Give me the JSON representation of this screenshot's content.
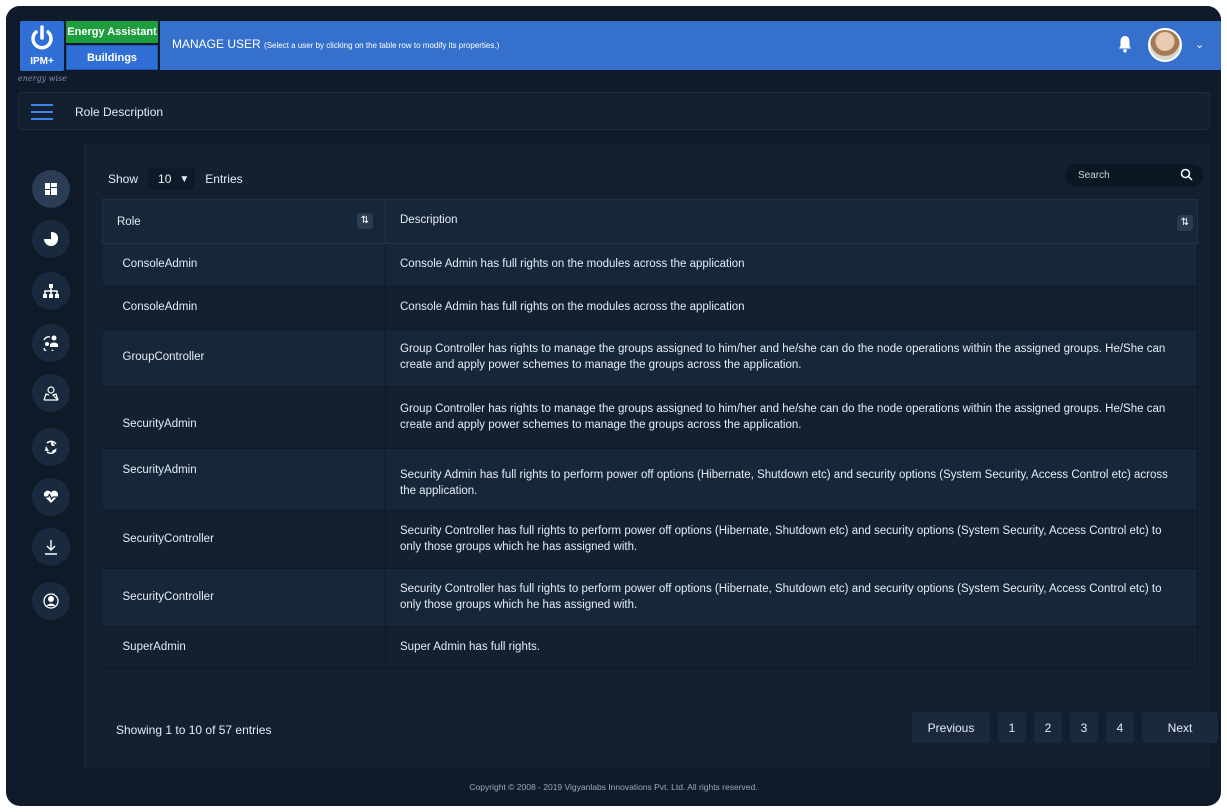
{
  "app": {
    "logo_text": "IPM+",
    "logo_sub": "energy wise",
    "tag_energy": "Energy Assistant",
    "tag_buildings": "Buildings",
    "page_title": "MANAGE USER",
    "page_hint": "(Select a user by clicking on the table row to modify its properties.)"
  },
  "breadcrumb": {
    "label": "Role Description"
  },
  "sidebar": {
    "items": [
      {
        "icon": "dashboard-icon"
      },
      {
        "icon": "pie-chart-icon"
      },
      {
        "icon": "hierarchy-icon"
      },
      {
        "icon": "user-sync-icon"
      },
      {
        "icon": "map-user-icon"
      },
      {
        "icon": "recycle-icon"
      },
      {
        "icon": "heartbeat-icon"
      },
      {
        "icon": "download-icon"
      },
      {
        "icon": "user-icon"
      }
    ]
  },
  "controls": {
    "show_label": "Show",
    "entries_value": "10",
    "entries_label": "Entries",
    "search_placeholder": "Search"
  },
  "table": {
    "columns": [
      "Role",
      "Description"
    ],
    "rows": [
      {
        "role": "ConsoleAdmin",
        "description": "Console Admin has full rights on the modules across the application"
      },
      {
        "role": "ConsoleAdmin",
        "description": "Console Admin has full rights on the modules across the application"
      },
      {
        "role": "GroupController",
        "description": "Group Controller has rights to manage the groups assigned to him/her and he/she can do the node operations within the assigned groups. He/She can create and apply power schemes to manage the groups across the application."
      },
      {
        "role": "SecurityAdmin",
        "description": "Group Controller has rights to manage the groups assigned to him/her and he/she can do the node operations within the assigned groups. He/She can create and apply power schemes to manage the groups across the application."
      },
      {
        "role": "SecurityAdmin",
        "description": "Security Admin has full rights to perform power off options (Hibernate, Shutdown etc) and security options (System Security, Access Control etc) across the application."
      },
      {
        "role": "SecurityController",
        "description": "Security Controller has full rights to perform power off options (Hibernate, Shutdown etc) and security options (System Security, Access Control etc) to only those groups which he has assigned with."
      },
      {
        "role": "SecurityController",
        "description": "Security Controller has full rights to perform power off options (Hibernate, Shutdown etc) and security options (System Security, Access Control etc) to only those groups which he has assigned with."
      },
      {
        "role": "SuperAdmin",
        "description": "Super Admin has full rights."
      }
    ]
  },
  "pagination": {
    "info": "Showing 1 to 10 of 57 entries",
    "previous": "Previous",
    "pages": [
      "1",
      "2",
      "3",
      "4"
    ],
    "next": "Next"
  },
  "footer": {
    "copyright": "Copyright © 2008 - 2019  Vigyanlabs Innovations Pvt. Ltd. All rights reserved."
  }
}
